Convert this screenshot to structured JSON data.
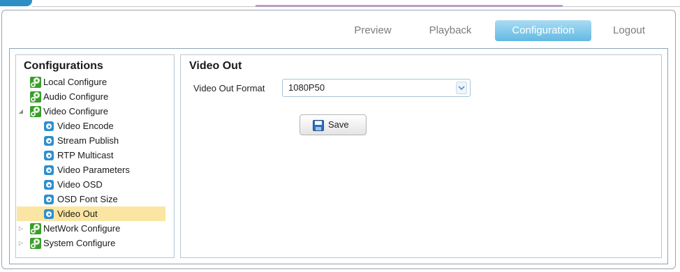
{
  "nav": {
    "tabs": [
      {
        "label": "Preview",
        "active": false
      },
      {
        "label": "Playback",
        "active": false
      },
      {
        "label": "Configuration",
        "active": true
      },
      {
        "label": "Logout",
        "active": false
      }
    ],
    "active_color": "#63b9e3"
  },
  "sidebar": {
    "title": "Configurations",
    "items": [
      {
        "label": "Local Configure",
        "icon": "gear-green-icon"
      },
      {
        "label": "Audio Configure",
        "icon": "gear-green-icon"
      },
      {
        "label": "Video Configure",
        "icon": "gear-green-icon",
        "expanded": true
      },
      {
        "label": "Video Encode",
        "icon": "gear-blue-icon"
      },
      {
        "label": "Stream Publish",
        "icon": "gear-blue-icon"
      },
      {
        "label": "RTP Multicast",
        "icon": "gear-blue-icon"
      },
      {
        "label": "Video Parameters",
        "icon": "gear-blue-icon"
      },
      {
        "label": "Video OSD",
        "icon": "gear-blue-icon"
      },
      {
        "label": "OSD Font Size",
        "icon": "gear-blue-icon"
      },
      {
        "label": "Video Out",
        "icon": "gear-blue-icon",
        "selected": true
      },
      {
        "label": "NetWork Configure",
        "icon": "gear-green-icon",
        "expanded": false
      },
      {
        "label": "System Configure",
        "icon": "gear-green-icon",
        "expanded": false
      }
    ],
    "selected_color": "#fae6a2"
  },
  "main": {
    "title": "Video Out",
    "video_out_format": {
      "label": "Video Out Format",
      "value": "1080P50"
    },
    "save_label": "Save"
  }
}
